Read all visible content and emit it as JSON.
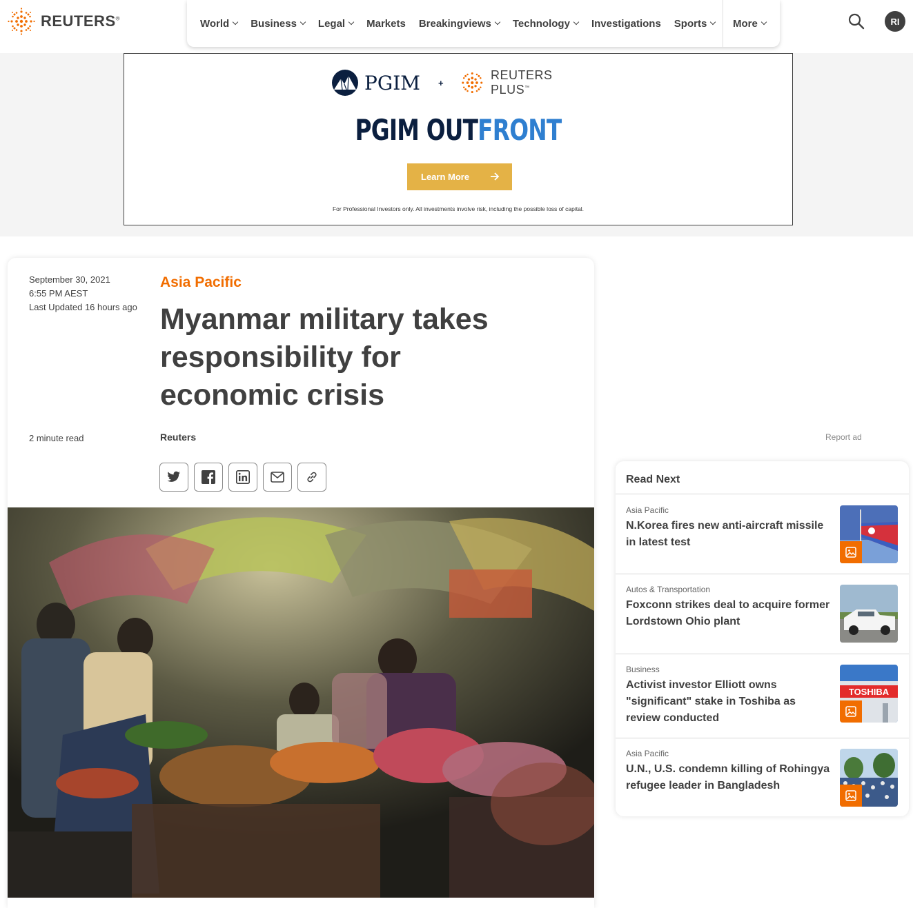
{
  "header": {
    "brand": "REUTERS",
    "brand_mark": "®",
    "nav": [
      {
        "label": "World",
        "dropdown": true
      },
      {
        "label": "Business",
        "dropdown": true
      },
      {
        "label": "Legal",
        "dropdown": true
      },
      {
        "label": "Markets",
        "dropdown": false
      },
      {
        "label": "Breakingviews",
        "dropdown": true
      },
      {
        "label": "Technology",
        "dropdown": true
      },
      {
        "label": "Investigations",
        "dropdown": false
      },
      {
        "label": "Sports",
        "dropdown": true
      }
    ],
    "more_label": "More",
    "search_icon": "search-icon",
    "avatar_initials": "RI"
  },
  "ad": {
    "pgim": "PGIM",
    "plus": "+",
    "partner": "REUTERS PLUS",
    "partner_mark": "™",
    "headline_main": "PGIM OUT",
    "headline_accent": "FRONT",
    "cta": "Learn More",
    "disclaimer": "For Professional Investors only. All investments involve risk, including the possible loss of capital."
  },
  "article": {
    "date": "September 30, 2021",
    "time": "6:55 PM AEST",
    "updated": "Last Updated 16 hours ago",
    "section": "Asia Pacific",
    "headline": "Myanmar military takes responsibility for economic crisis",
    "read_time": "2 minute read",
    "byline": "Reuters",
    "share_icons": [
      "twitter-icon",
      "facebook-icon",
      "linkedin-icon",
      "email-icon",
      "link-icon"
    ]
  },
  "sidebar": {
    "report_ad": "Report ad",
    "read_next_title": "Read Next",
    "items": [
      {
        "category": "Asia Pacific",
        "headline": "N.Korea fires new anti-aircraft missile in latest test"
      },
      {
        "category": "Autos & Transportation",
        "headline": "Foxconn strikes deal to acquire former Lordstown Ohio plant"
      },
      {
        "category": "Business",
        "headline": "Activist investor Elliott owns \"significant\" stake in Toshiba as review conducted"
      },
      {
        "category": "Asia Pacific",
        "headline": "U.N., U.S. condemn killing of Rohingya refugee leader in Bangladesh"
      }
    ],
    "thumb_labels": {
      "toshiba_sign": "TOSHIBA"
    }
  },
  "colors": {
    "accent_orange": "#f16d00",
    "text": "#404040",
    "ad_gold": "#e4b246",
    "ad_navy": "#0b1f3f",
    "ad_blue": "#2f7fd0"
  }
}
